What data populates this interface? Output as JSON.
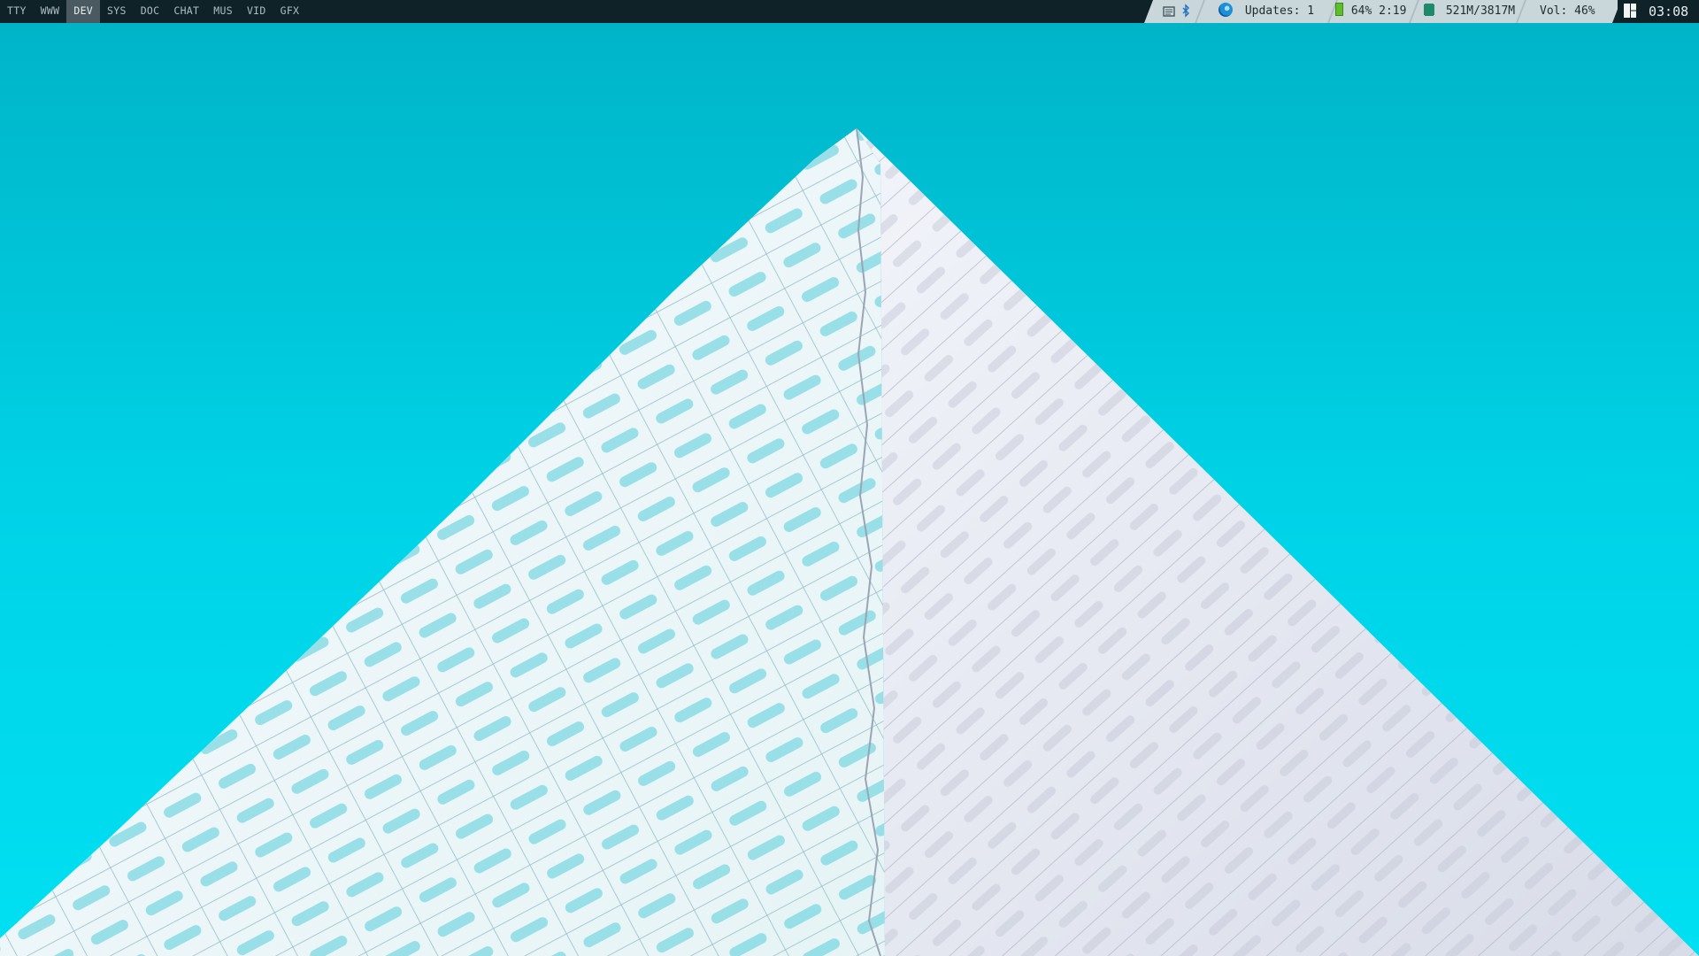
{
  "workspaces": [
    "TTY",
    "WWW",
    "DEV",
    "SYS",
    "DOC",
    "CHAT",
    "MUS",
    "VID",
    "GFX"
  ],
  "active_workspace": "DEV",
  "status": {
    "updates": "Updates: 1",
    "battery": "64% 2:19",
    "memory": "521M/3817M",
    "volume": "Vol: 46%"
  },
  "clock": "03:08",
  "icons": {
    "tray_1": "window-list-icon",
    "tray_2": "bluetooth-icon",
    "updates": "arch-spiral-icon",
    "battery": "battery-icon",
    "memory": "ram-chip-icon",
    "layout": "tiling-layout-icon"
  },
  "colors": {
    "bar_bg": "#0f2228",
    "status_bg": "#c9d6da",
    "sky": "#00cfe2",
    "battery_green": "#5fbf2a",
    "chip_green": "#1e8a6a"
  }
}
